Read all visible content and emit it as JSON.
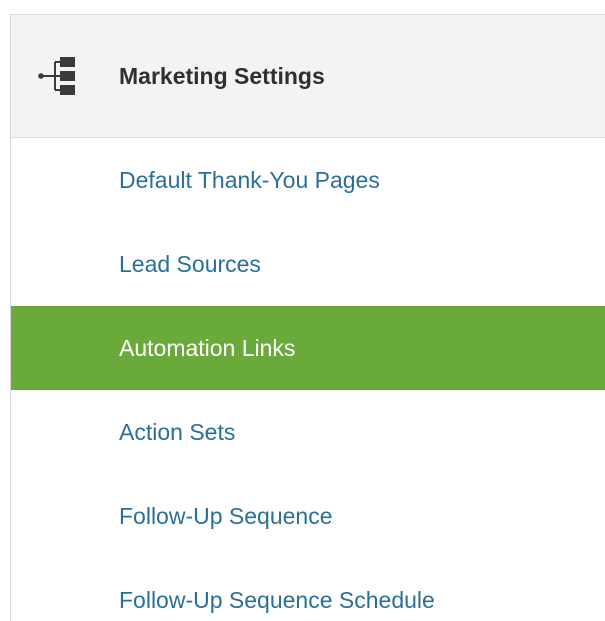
{
  "section": {
    "title": "Marketing Settings",
    "icon": "tree-structure-icon"
  },
  "menu": {
    "items": [
      {
        "label": "Default Thank-You Pages",
        "active": false
      },
      {
        "label": "Lead Sources",
        "active": false
      },
      {
        "label": "Automation Links",
        "active": true
      },
      {
        "label": "Action Sets",
        "active": false
      },
      {
        "label": "Follow-Up Sequence",
        "active": false
      },
      {
        "label": "Follow-Up Sequence Schedule",
        "active": false
      }
    ]
  },
  "colors": {
    "link": "#2a6f97",
    "active_background": "#6aaa3a",
    "active_text": "#ffffff",
    "header_background": "#f3f3f3",
    "header_text": "#2f2f2f"
  }
}
